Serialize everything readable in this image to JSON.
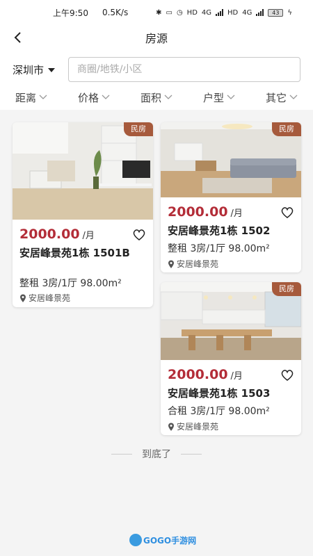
{
  "status_bar": {
    "time": "上午9:50",
    "net_speed": "0.5K/s",
    "net1": "4G",
    "net2": "4G",
    "battery": "43",
    "icons": [
      "bluetooth-icon",
      "vibrate-icon",
      "alarm-icon",
      "hd-icon",
      "signal-icon",
      "hd-icon",
      "signal-icon",
      "battery-icon",
      "charging-icon"
    ]
  },
  "header": {
    "title": "房源",
    "back_icon": "back-arrow-icon"
  },
  "filter": {
    "city": "深圳市",
    "search_placeholder": "商圈/地铁/小区",
    "tabs": [
      {
        "label": "距离"
      },
      {
        "label": "价格"
      },
      {
        "label": "面积"
      },
      {
        "label": "户型"
      },
      {
        "label": "其它"
      }
    ]
  },
  "listings": [
    {
      "badge": "民房",
      "price": "2000.00",
      "unit": "/月",
      "title": "安居峰景苑1栋 1501B",
      "detail": "整租  3房/1厅  98.00m²",
      "location": "安居峰景苑",
      "favorited": false
    },
    {
      "badge": "民房",
      "price": "2000.00",
      "unit": "/月",
      "title": "安居峰景苑1栋  1502",
      "detail": "整租  3房/1厅  98.00m²",
      "location": "安居峰景苑",
      "favorited": false
    },
    {
      "badge": "民房",
      "price": "2000.00",
      "unit": "/月",
      "title": "安居峰景苑1栋  1503",
      "detail": "合租  3房/1厅  98.00m²",
      "location": "安居峰景苑",
      "favorited": false
    }
  ],
  "end_text": "到底了",
  "watermark": {
    "text": "GOGO手游网"
  },
  "colors": {
    "price": "#b32d38",
    "badge": "#a65a3c",
    "accent": "#2f8fe0"
  }
}
